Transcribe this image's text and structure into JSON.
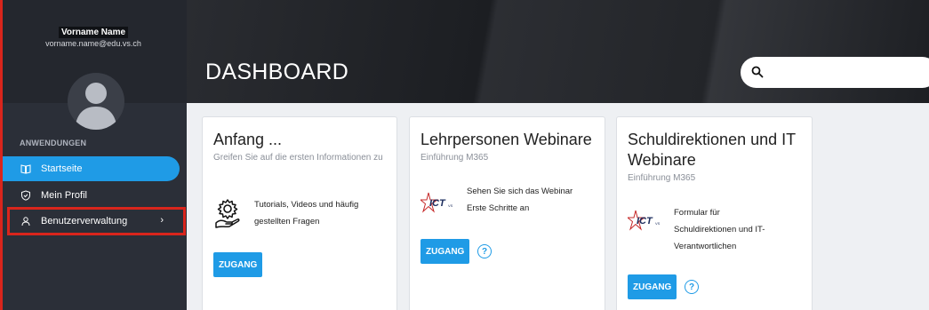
{
  "user": {
    "name": "Vorname Name",
    "email": "vorname.name@edu.vs.ch"
  },
  "sidebar": {
    "section_title": "ANWENDUNGEN",
    "items": [
      {
        "label": "Startseite",
        "icon": "book-icon",
        "active": true
      },
      {
        "label": "Mein Profil",
        "icon": "shield-check-icon",
        "active": false
      },
      {
        "label": "Benutzerverwaltung",
        "icon": "user-icon",
        "active": false,
        "chevron": "›"
      }
    ]
  },
  "header": {
    "title": "DASHBOARD",
    "search_placeholder": ""
  },
  "cards": [
    {
      "title": "Anfang ...",
      "subtitle": "Greifen Sie auf die ersten Informationen zu",
      "icon": "gear-hand-icon",
      "feature_lines": [
        "Tutorials, Videos und häufig",
        "gestellten Fragen"
      ],
      "button": "ZUGANG",
      "help": false
    },
    {
      "title": "Lehrpersonen Webinare",
      "subtitle": "Einführung M365",
      "icon": "ict-logo",
      "feature_lines": [
        "Sehen Sie sich das Webinar",
        "Erste Schritte an"
      ],
      "button": "ZUGANG",
      "help": true,
      "help_symbol": "?"
    },
    {
      "title_lines": [
        "Schuldirektionen und IT",
        "Webinare"
      ],
      "subtitle": "Einführung M365",
      "icon": "ict-logo",
      "feature_lines": [
        "Formular für",
        "Schuldirektionen und IT-",
        "Verantwortlichen"
      ],
      "button": "ZUGANG",
      "help": true,
      "help_symbol": "?"
    }
  ],
  "logo_text": "ICT",
  "logo_suffix": "VS",
  "colors": {
    "accent": "#1f9be6",
    "sidebar": "#2b2f38",
    "highlight": "#d9251c"
  }
}
